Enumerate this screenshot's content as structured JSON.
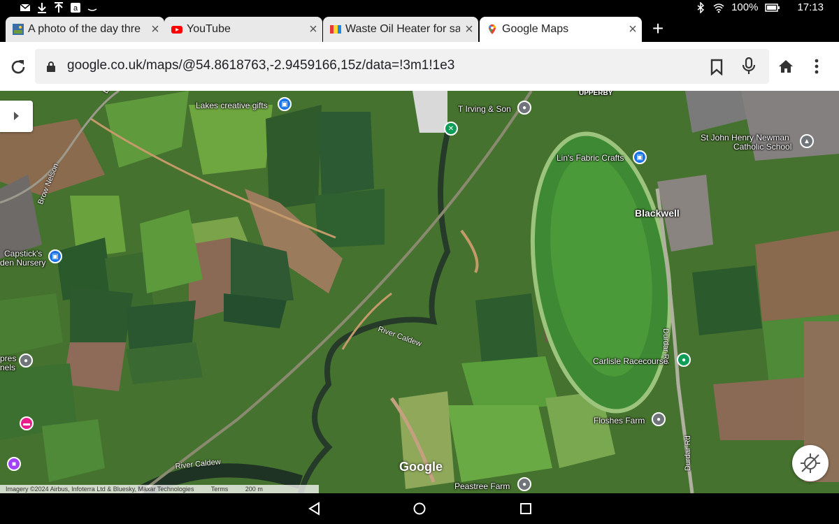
{
  "status_bar": {
    "icons_left": [
      "mail-icon",
      "download-icon",
      "upload-icon",
      "amazon-icon",
      "cloud-icon"
    ],
    "icons_right": [
      "bluetooth-icon",
      "wifi-icon",
      "battery-icon"
    ],
    "battery": "100%",
    "time": "17:13"
  },
  "tabs": [
    {
      "title": "A photo of the day thre",
      "favicon": "photo-favicon",
      "active": false
    },
    {
      "title": "YouTube",
      "favicon": "youtube-favicon",
      "active": false
    },
    {
      "title": "Waste Oil Heater for sa",
      "favicon": "heater-favicon",
      "active": false
    },
    {
      "title": "Google Maps",
      "favicon": "maps-favicon",
      "active": true
    }
  ],
  "toolbar": {
    "url": "google.co.uk/maps/@54.8618763,-2.9459166,15z/data=!3m1!1e3"
  },
  "map": {
    "places": {
      "lakes_creative_gifts": "Lakes creative gifts",
      "t_irving": "T Irving & Son",
      "upperby": "UPPERBY",
      "st_john_1": "St John Henry Newman",
      "st_john_2": "Catholic School",
      "lins_fabric": "Lin's Fabric Crafts",
      "blackwell": "Blackwell",
      "capsticks_1": "Capstick's",
      "capsticks_2": "den Nursery",
      "brow_nelson": "Brow Nelson",
      "river_caldew_1": "River Caldew",
      "river_caldew_2": "River Caldew",
      "durdar_rd_1": "Durdar Rd",
      "durdar_rd_2": "Durdar Rd",
      "carlisle_racecourse": "Carlisle Racecourse",
      "floshes_farm": "Floshes Farm",
      "peastree_farm": "Peastree Farm",
      "pores_1": "pres",
      "pores_2": "nels",
      "ln_fragment": "Ln"
    },
    "google_logo": "Google",
    "attribution": {
      "imagery": "Imagery ©2024 Airbus, Infoterra Ltd & Bluesky, Maxar Technologies",
      "terms": "Terms",
      "scale": "200 m"
    },
    "colors": {
      "shopping_pin": "#1a73e8",
      "restaurant_pin": "#0f9d58",
      "generic_pin": "#70757a",
      "hotel_pin": "#e91e8c",
      "lodging_pin": "#a142f4"
    }
  }
}
